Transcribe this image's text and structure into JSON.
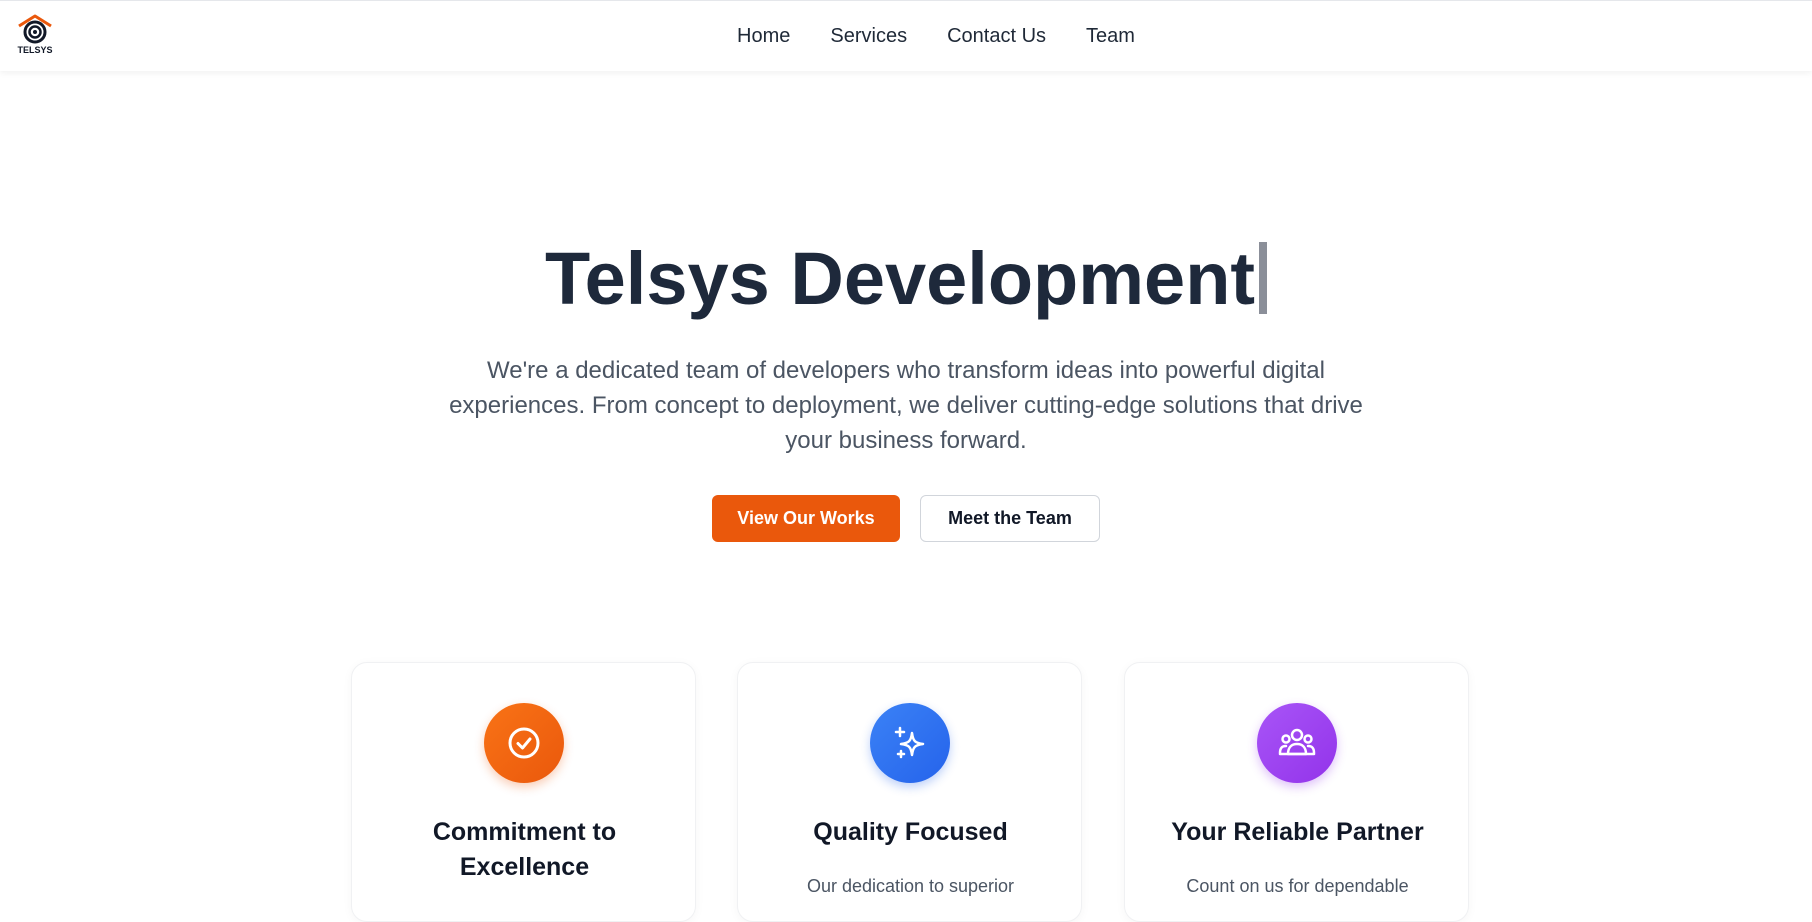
{
  "brand": {
    "logo_text": "TELSYS",
    "accent_color": "#ea580c"
  },
  "nav": {
    "items": [
      {
        "label": "Home"
      },
      {
        "label": "Services"
      },
      {
        "label": "Contact Us"
      },
      {
        "label": "Team"
      }
    ]
  },
  "hero": {
    "title": "Telsys Development",
    "description": "We're a dedicated team of developers who transform ideas into powerful digital experiences. From concept to deployment, we deliver cutting-edge solutions that drive your business forward.",
    "primary_button": "View Our Works",
    "secondary_button": "Meet the Team"
  },
  "features": [
    {
      "icon": "check-circle-icon",
      "color": "#f97316",
      "title": "Commitment to Excellence",
      "description": ""
    },
    {
      "icon": "sparkles-icon",
      "color": "#3b82f6",
      "title": "Quality Focused",
      "description": "Our dedication to superior"
    },
    {
      "icon": "users-icon",
      "color": "#a855f7",
      "title": "Your Reliable Partner",
      "description": "Count on us for dependable"
    }
  ]
}
